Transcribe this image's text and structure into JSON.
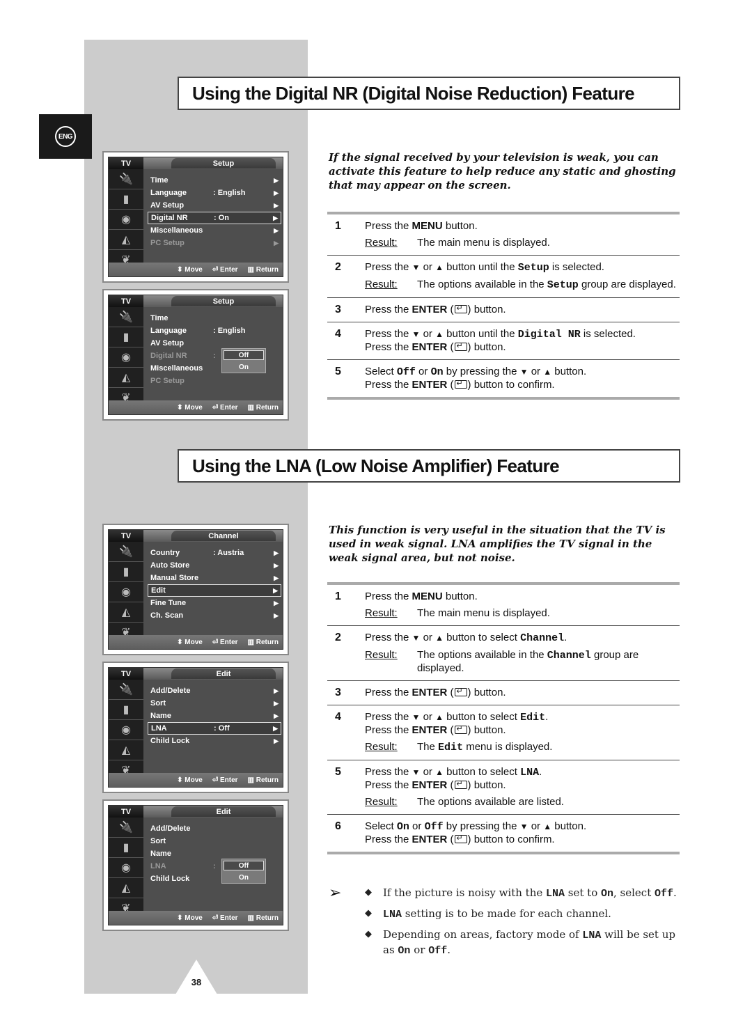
{
  "language_tab": "ENG",
  "page_number": "38",
  "osd_footer": {
    "move": "Move",
    "enter": "Enter",
    "return": "Return"
  },
  "osd_tv_label": "TV",
  "sections": [
    {
      "title": "Using the Digital NR (Digital Noise Reduction) Feature",
      "intro": "If the signal received by your television is weak, you can activate this feature to help reduce any static and ghosting that may appear on the screen.",
      "steps": [
        {
          "num": "1",
          "lines": [
            "Press the <b>MENU</b> button."
          ],
          "result": "The main menu is displayed."
        },
        {
          "num": "2",
          "lines": [
            "Press the <span class='tri'>▼</span> or <span class='tri'>▲</span> button until the <span class='mono'>Setup</span> is selected."
          ],
          "result": "The options available in the <span class='mono'>Setup</span> group are displayed."
        },
        {
          "num": "3",
          "lines": [
            "Press the <b>ENTER</b> (<span class='enter-glyph'></span>) button."
          ]
        },
        {
          "num": "4",
          "lines": [
            "Press the <span class='tri'>▼</span> or <span class='tri'>▲</span> button until the <span class='mono'>Digital NR</span> is selected.",
            "Press the <b>ENTER</b> (<span class='enter-glyph'></span>) button."
          ]
        },
        {
          "num": "5",
          "lines": [
            "Select <span class='mono'>Off</span> or <span class='mono'>On</span> by pressing the <span class='tri'>▼</span> or <span class='tri'>▲</span> button.",
            "Press the <b>ENTER</b> (<span class='enter-glyph'></span>) button to confirm."
          ]
        }
      ],
      "screens": [
        {
          "title": "Setup",
          "items": [
            {
              "label": "Time",
              "value": "",
              "arrow": true
            },
            {
              "label": "Language",
              "value": ": English",
              "arrow": true
            },
            {
              "label": "AV Setup",
              "value": "",
              "arrow": true
            },
            {
              "label": "Digital NR",
              "value": ": On",
              "arrow": true,
              "selected": true
            },
            {
              "label": "Miscellaneous",
              "value": "",
              "arrow": true
            },
            {
              "label": "PC Setup",
              "value": "",
              "arrow": true,
              "dim": true
            }
          ]
        },
        {
          "title": "Setup",
          "popup_row": 3,
          "popup": [
            "Off",
            "On"
          ],
          "items": [
            {
              "label": "Time",
              "value": ""
            },
            {
              "label": "Language",
              "value": ": English"
            },
            {
              "label": "AV Setup",
              "value": ""
            },
            {
              "label": "Digital NR",
              "value": ":",
              "dim": true
            },
            {
              "label": "Miscellaneous",
              "value": ""
            },
            {
              "label": "PC Setup",
              "value": "",
              "dim": true
            }
          ]
        }
      ]
    },
    {
      "title": "Using the LNA (Low Noise Amplifier) Feature",
      "intro": "This function is very useful in the situation that the TV is used in weak signal. LNA amplifies the TV signal in the weak signal area, but not noise.",
      "steps": [
        {
          "num": "1",
          "lines": [
            "Press the <b>MENU</b> button."
          ],
          "result": "The main menu is displayed."
        },
        {
          "num": "2",
          "lines": [
            "Press the <span class='tri'>▼</span> or <span class='tri'>▲</span> button to select <span class='mono'>Channel</span>."
          ],
          "result": "The options available in the <span class='mono'>Channel</span> group are displayed."
        },
        {
          "num": "3",
          "lines": [
            "Press the <b>ENTER</b> (<span class='enter-glyph'></span>) button."
          ]
        },
        {
          "num": "4",
          "lines": [
            "Press the <span class='tri'>▼</span> or <span class='tri'>▲</span> button to select <span class='mono'>Edit</span>.",
            "Press the <b>ENTER</b> (<span class='enter-glyph'></span>) button."
          ],
          "result": "The <span class='mono'>Edit</span> menu is displayed."
        },
        {
          "num": "5",
          "lines": [
            "Press the <span class='tri'>▼</span> or <span class='tri'>▲</span> button to select <span class='mono'>LNA</span>.",
            "Press the <b>ENTER</b> (<span class='enter-glyph'></span>) button."
          ],
          "result": "The options available are listed."
        },
        {
          "num": "6",
          "lines": [
            "Select <span class='mono'>On</span> or <span class='mono'>Off</span> by pressing the <span class='tri'>▼</span> or <span class='tri'>▲</span> button.",
            "Press the <b>ENTER</b> (<span class='enter-glyph'></span>) button to confirm."
          ]
        }
      ],
      "screens": [
        {
          "title": "Channel",
          "items": [
            {
              "label": "Country",
              "value": ": Austria",
              "arrow": true
            },
            {
              "label": "Auto Store",
              "value": "",
              "arrow": true
            },
            {
              "label": "Manual Store",
              "value": "",
              "arrow": true
            },
            {
              "label": "Edit",
              "value": "",
              "arrow": true,
              "selected": true
            },
            {
              "label": "Fine Tune",
              "value": "",
              "arrow": true
            },
            {
              "label": "Ch. Scan",
              "value": "",
              "arrow": true
            }
          ]
        },
        {
          "title": "Edit",
          "items": [
            {
              "label": "Add/Delete",
              "value": "",
              "arrow": true
            },
            {
              "label": "Sort",
              "value": "",
              "arrow": true
            },
            {
              "label": "Name",
              "value": "",
              "arrow": true
            },
            {
              "label": "LNA",
              "value": ": Off",
              "arrow": true,
              "selected": true
            },
            {
              "label": "Child Lock",
              "value": "",
              "arrow": true
            }
          ]
        },
        {
          "title": "Edit",
          "popup_row": 3,
          "popup": [
            "Off",
            "On"
          ],
          "items": [
            {
              "label": "Add/Delete",
              "value": ""
            },
            {
              "label": "Sort",
              "value": ""
            },
            {
              "label": "Name",
              "value": ""
            },
            {
              "label": "LNA",
              "value": ":",
              "dim": true
            },
            {
              "label": "Child Lock",
              "value": ""
            }
          ]
        }
      ],
      "notes": [
        "If the picture is noisy with the <span class='mono'>LNA</span> set to <span class='mono'>On</span>, select <span class='mono'>Off</span>.",
        "<span class='mono'>LNA</span> setting is to be made for each channel.",
        "Depending on areas, factory mode of <span class='mono'>LNA</span> will be set up as <span class='mono'>On</span> or <span class='mono'>Off</span>."
      ]
    }
  ],
  "osd_icons": [
    "input-icon",
    "picture-icon",
    "sound-icon",
    "channel-icon",
    "setup-icon"
  ]
}
